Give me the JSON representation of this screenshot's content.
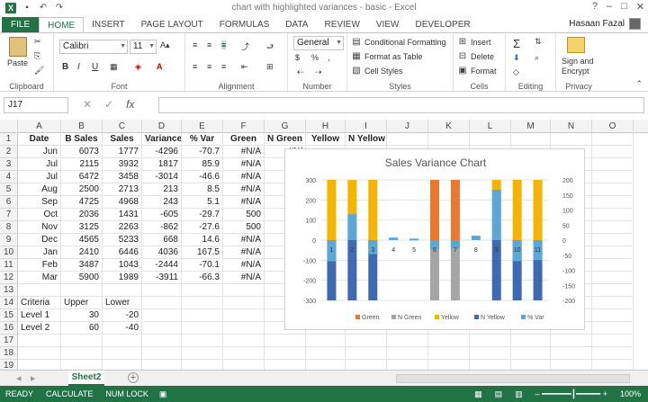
{
  "window": {
    "title": "chart with highlighted variances - basic - Excel"
  },
  "tabs": [
    "FILE",
    "HOME",
    "INSERT",
    "PAGE LAYOUT",
    "FORMULAS",
    "DATA",
    "REVIEW",
    "VIEW",
    "DEVELOPER"
  ],
  "user": {
    "name": "Hasaan Fazal"
  },
  "ribbon": {
    "clipboard": {
      "label": "Clipboard",
      "paste": "Paste"
    },
    "font": {
      "label": "Font",
      "name": "Calibri",
      "size": "11",
      "bold": "B",
      "italic": "I",
      "underline": "U"
    },
    "alignment": {
      "label": "Alignment"
    },
    "number": {
      "label": "Number",
      "format": "General",
      "currency": "$",
      "percent": "%",
      "comma": ","
    },
    "styles": {
      "label": "Styles",
      "conditional": "Conditional Formatting",
      "format_table": "Format as Table",
      "cell_styles": "Cell Styles"
    },
    "cells": {
      "label": "Cells",
      "insert": "Insert",
      "delete": "Delete",
      "format": "Format"
    },
    "editing": {
      "label": "Editing"
    },
    "privacy": {
      "label": "Privacy",
      "sign": "Sign and",
      "encrypt": "Encrypt"
    }
  },
  "formula_bar": {
    "name_box": "J17",
    "fx": "fx",
    "value": ""
  },
  "columns": [
    "A",
    "B",
    "C",
    "D",
    "E",
    "F",
    "G",
    "H",
    "I",
    "J",
    "K",
    "L",
    "M",
    "N",
    "O"
  ],
  "rows": [
    "1",
    "2",
    "3",
    "4",
    "5",
    "6",
    "7",
    "8",
    "9",
    "10",
    "11",
    "12",
    "13",
    "14",
    "15",
    "16",
    "17",
    "18",
    "19"
  ],
  "sheet": {
    "headers": [
      "Date",
      "B Sales",
      "Sales",
      "Variance",
      "% Var",
      "Green",
      "N Green",
      "Yellow",
      "N Yellow"
    ],
    "data": [
      [
        "Jun",
        "6073",
        "1777",
        "-4296",
        "-70.7",
        "#N/A",
        "#N/"
      ],
      [
        "Jul",
        "2115",
        "3932",
        "1817",
        "85.9",
        "#N/A",
        "#N/"
      ],
      [
        "Jul",
        "6472",
        "3458",
        "-3014",
        "-46.6",
        "#N/A",
        "#N/"
      ],
      [
        "Aug",
        "2500",
        "2713",
        "213",
        "8.5",
        "#N/A",
        "#N/"
      ],
      [
        "Sep",
        "4725",
        "4968",
        "243",
        "5.1",
        "#N/A",
        "#N/"
      ],
      [
        "Oct",
        "2036",
        "1431",
        "-605",
        "-29.7",
        "500",
        ""
      ],
      [
        "Nov",
        "3125",
        "2263",
        "-862",
        "-27.6",
        "500",
        ""
      ],
      [
        "Dec",
        "4565",
        "5233",
        "668",
        "14.6",
        "#N/A",
        "#N/"
      ],
      [
        "Jan",
        "2410",
        "6446",
        "4036",
        "167.5",
        "#N/A",
        "#N/"
      ],
      [
        "Feb",
        "3487",
        "1043",
        "-2444",
        "-70.1",
        "#N/A",
        "#N/"
      ],
      [
        "Mar",
        "5900",
        "1989",
        "-3911",
        "-66.3",
        "#N/A",
        "#N/"
      ]
    ],
    "criteria": {
      "title": "Criteria",
      "upper": "Upper",
      "lower": "Lower",
      "rows": [
        [
          "Level 1",
          "30",
          "-20"
        ],
        [
          "Level 2",
          "60",
          "-40"
        ]
      ]
    }
  },
  "chart_data": {
    "type": "bar",
    "title": "Sales Variance Chart",
    "categories": [
      "1",
      "2",
      "3",
      "4",
      "5",
      "6",
      "7",
      "8",
      "9",
      "10",
      "11"
    ],
    "series": [
      {
        "name": "Green",
        "color": "#e8792f",
        "values": [
          null,
          null,
          null,
          null,
          null,
          500,
          500,
          null,
          null,
          null,
          null
        ]
      },
      {
        "name": "N Green",
        "color": "#a5a5a5",
        "values": [
          null,
          null,
          null,
          null,
          null,
          -500,
          -500,
          null,
          null,
          null,
          null
        ]
      },
      {
        "name": "Yellow",
        "color": "#f4b400",
        "values": [
          500,
          500,
          500,
          null,
          null,
          null,
          null,
          null,
          500,
          500,
          500
        ]
      },
      {
        "name": "N Yellow",
        "color": "#3d6ab3",
        "values": [
          -500,
          -500,
          -500,
          null,
          null,
          null,
          null,
          null,
          -500,
          -500,
          -500
        ]
      },
      {
        "name": "% Var",
        "color": "#5ba7d8",
        "values": [
          -70.7,
          85.9,
          -46.6,
          8.5,
          5.1,
          -29.7,
          -27.6,
          14.6,
          167.5,
          -70.1,
          -66.3
        ]
      }
    ],
    "left_axis": {
      "ticks": [
        "300",
        "200",
        "100",
        "0",
        "-100",
        "-200",
        "-300"
      ],
      "range": [
        -300,
        300
      ]
    },
    "right_axis": {
      "ticks": [
        "200",
        "150",
        "100",
        "50",
        "0",
        "-50",
        "-100",
        "-150",
        "-200"
      ],
      "range": [
        -200,
        200
      ]
    }
  },
  "sheet_tabs": {
    "active": "Sheet2"
  },
  "status": {
    "ready": "READY",
    "calc": "CALCULATE",
    "numlock": "NUM LOCK",
    "zoom": "100%"
  }
}
